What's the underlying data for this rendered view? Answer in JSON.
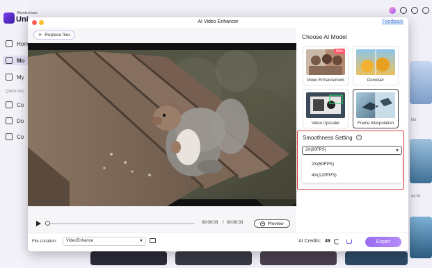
{
  "background_app": {
    "brand_small": "Wondershare",
    "brand": "Uni",
    "sidebar": {
      "items": [
        {
          "label": "Hom",
          "icon": "home-icon"
        },
        {
          "label": "Mo",
          "icon": "grid-icon"
        },
        {
          "label": "My",
          "icon": "file-icon"
        }
      ],
      "section_head": "Quick Acc",
      "quick_items": [
        {
          "label": "Co",
          "icon": "convert-icon"
        },
        {
          "label": "Do",
          "icon": "download-icon"
        },
        {
          "label": "Co",
          "icon": "compress-icon"
        }
      ]
    },
    "top_icons": [
      "avatar-icon",
      "headset-icon",
      "chat-icon",
      "menu-icon"
    ],
    "right_snippets": {
      "a": "les",
      "b": "as to"
    }
  },
  "dialog": {
    "title": "AI Video Enhancer",
    "feedback_label": "Feedback",
    "replace_files_label": "Replace files",
    "player": {
      "current_time": "00:00:03",
      "separator": "/",
      "total_time": "00:00:03",
      "preview_label": "Preview",
      "progress_fraction": 0.0
    },
    "file_location": {
      "label": "File Location:",
      "value": "VideoEnhance"
    },
    "credits": {
      "label": "AI Credits:",
      "value": "49"
    },
    "export_label": "Export",
    "ai_model": {
      "title": "Choose AI Model",
      "models": [
        {
          "label": "Video Enhancement",
          "badge": "New",
          "selected": false
        },
        {
          "label": "Denoiser",
          "badge": "",
          "selected": false
        },
        {
          "label": "Video Upscaler",
          "badge": "",
          "selected": false
        },
        {
          "label": "Frame Interpolation",
          "badge": "",
          "selected": true
        }
      ]
    },
    "smoothness": {
      "title": "Smoothness Setting",
      "info_icon": "i",
      "selected": "2X(60FPS)",
      "options": [
        "2X(60FPS)",
        "4X(120FPS)"
      ]
    }
  },
  "colors": {
    "accent": "#9a6cf2",
    "highlight_border": "#d9383a",
    "link": "#2f6fd6"
  }
}
